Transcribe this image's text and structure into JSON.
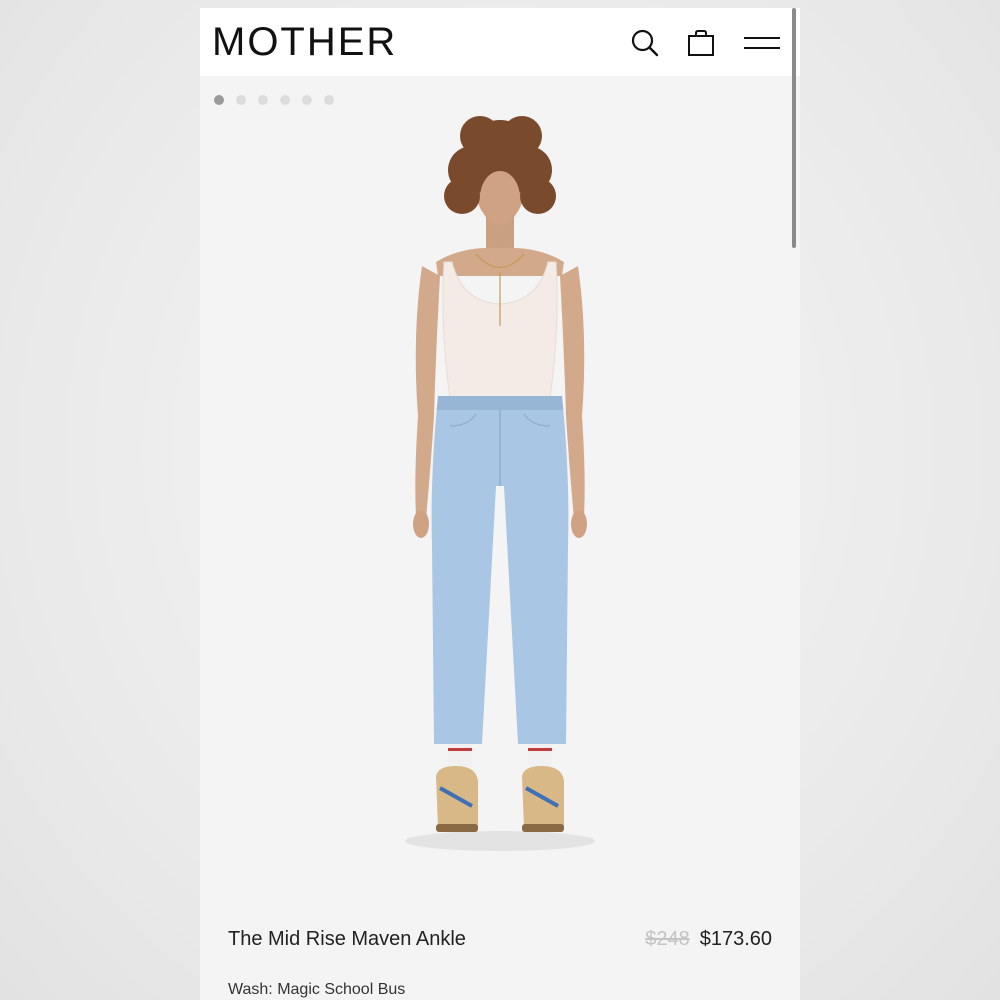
{
  "header": {
    "logo": "MOTHER",
    "icons": [
      "search-icon",
      "bag-icon",
      "menu-icon"
    ]
  },
  "carousel": {
    "total_images": 6,
    "active_index": 0
  },
  "product": {
    "name": "The Mid Rise Maven Ankle",
    "original_price": "$248",
    "sale_price": "$173.60",
    "wash_label": "Wash: Magic School Bus"
  },
  "colors": {
    "header_bg": "#ffffff",
    "page_bg": "#f4f4f4",
    "text": "#222222",
    "strikethrough": "#c4c4c4",
    "denim": "#a9c6e4"
  }
}
